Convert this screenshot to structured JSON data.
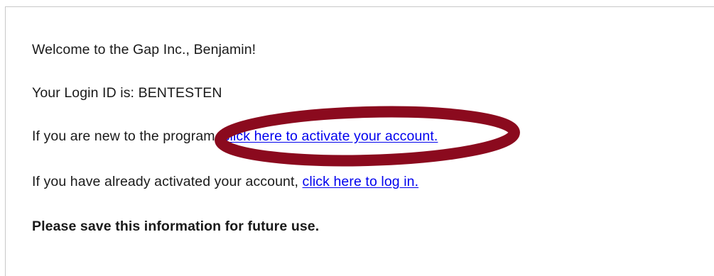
{
  "email": {
    "greeting": "Welcome to the Gap Inc., Benjamin!",
    "login_id_text": "Your Login ID is: BENTESTEN",
    "new_user_prefix": "If you are new to the program, ",
    "activate_link": "click here to activate your account.",
    "existing_user_prefix": "If you have already activated your account, ",
    "login_link": "click here to log in.",
    "save_notice": "Please save this information for future use."
  },
  "colors": {
    "link": "#0000ee",
    "annotation_oval": "#8b0a1e",
    "text": "#1a1a1a"
  }
}
